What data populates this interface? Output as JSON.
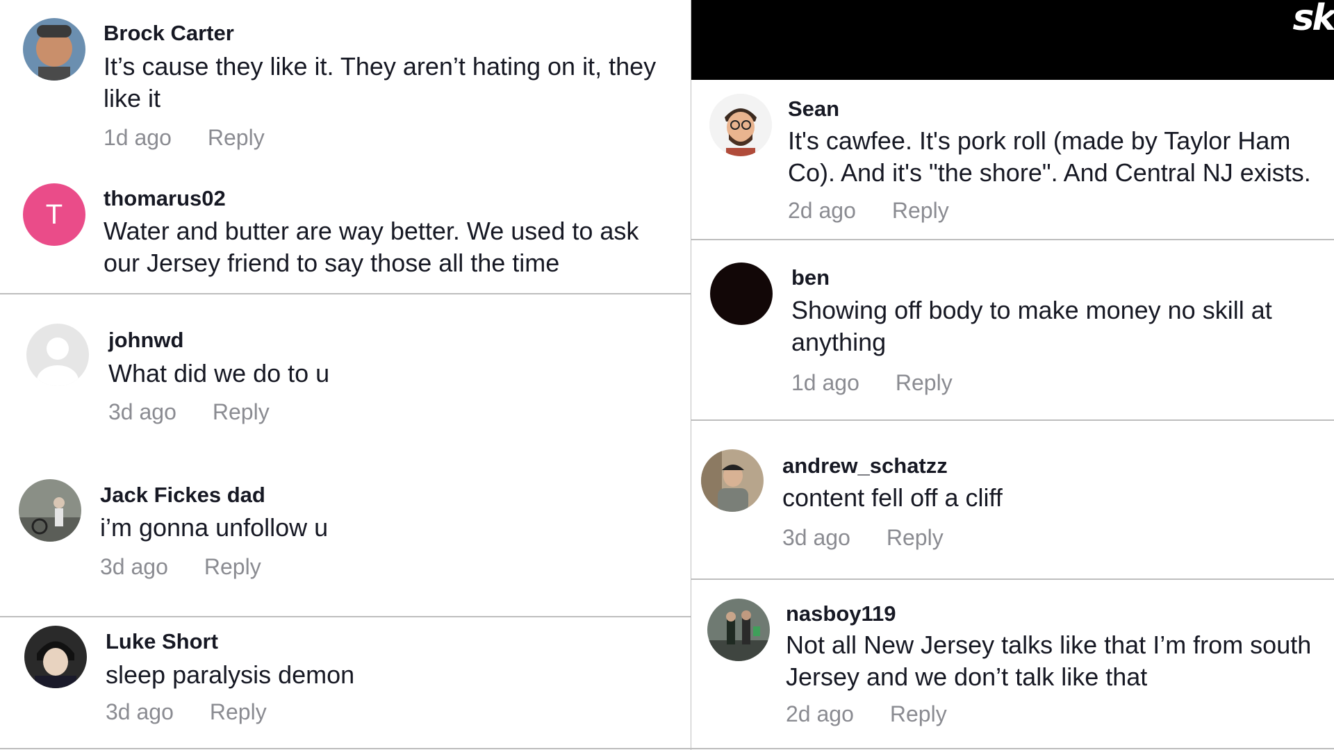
{
  "watermark": "sk",
  "left_column": [
    {
      "username": "Brock Carter",
      "text": "It’s cause they like it. They aren’t hating on it, they like it",
      "time": "1d ago",
      "reply": "Reply",
      "avatar": "photo-avatar"
    },
    {
      "username": "thomarus02",
      "text": "Water and butter are way better. We used to ask our Jersey friend to say those all the time",
      "avatar_letter": "T",
      "avatar_color": "#ea4c89"
    },
    {
      "username": "johnwd",
      "text": "What did we do to u",
      "time": "3d ago",
      "reply": "Reply",
      "avatar": "default-avatar"
    },
    {
      "username": "Jack Fickes dad",
      "text": "i’m gonna unfollow u",
      "time": "3d ago",
      "reply": "Reply",
      "avatar": "photo-avatar"
    },
    {
      "username": "Luke Short",
      "text": "sleep paralysis demon",
      "time": "3d ago",
      "reply": "Reply",
      "avatar": "photo-avatar"
    }
  ],
  "right_column": [
    {
      "username": "Sean",
      "text": "It's cawfee. It's pork roll (made by Taylor Ham Co). And it's \"the shore\". And Central NJ exists.",
      "time": "2d ago",
      "reply": "Reply",
      "avatar": "photo-avatar"
    },
    {
      "username": "ben",
      "text": "Showing off body to make money no skill at anything",
      "time": "1d ago",
      "reply": "Reply",
      "avatar": "dark-avatar"
    },
    {
      "username": "andrew_schatzz",
      "text": "content fell off a cliff",
      "time": "3d ago",
      "reply": "Reply",
      "avatar": "photo-avatar"
    },
    {
      "username": "nasboy119",
      "text": "Not all New Jersey talks like that I’m from south Jersey and we don’t talk like that",
      "time": "2d ago",
      "reply": "Reply",
      "avatar": "photo-avatar"
    }
  ],
  "colors": {
    "meta_text": "#8a8b91",
    "divider": "#bdbdbd",
    "topbar": "#000000",
    "text": "#161823"
  }
}
